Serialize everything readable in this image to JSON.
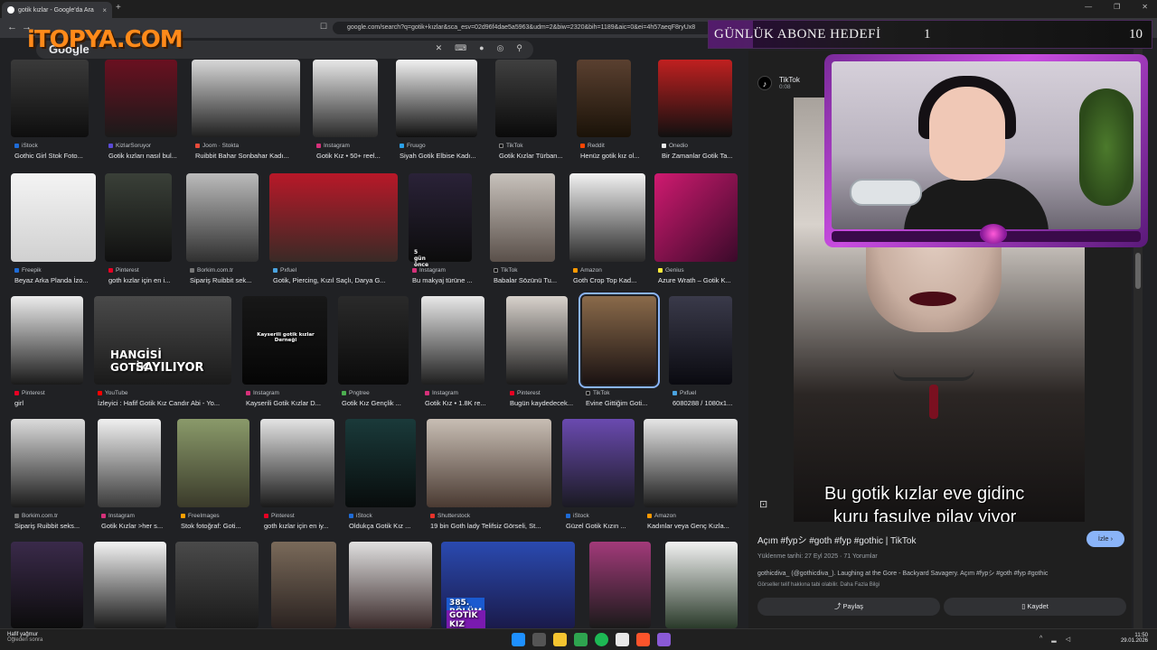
{
  "browser": {
    "tab_title": "gotik kızlar - Google'da Ara",
    "tab_close": "×",
    "new_tab": "+",
    "window_controls": [
      "—",
      "❐",
      "✕"
    ],
    "url": "google.com/search?q=gotik+kızlar&sca_esv=02d96f4dae5a5963&udm=2&biw=2320&bih=1189&aic=0&ei=4h57aeqF8ryUx8"
  },
  "logo": {
    "text": "iTOPYA.COM"
  },
  "search": {
    "brand": "Google",
    "icons": [
      "close-icon",
      "keyboard-icon",
      "mic-icon",
      "lens-icon",
      "search-icon"
    ]
  },
  "rows": [
    {
      "items": [
        {
          "source": "iStock",
          "title": "Gothic Girl Stok Foto..."
        },
        {
          "source": "KizlarSoruyor",
          "title": "Gotik kızları nasıl bul..."
        },
        {
          "source": "Joom · Stokta",
          "title": "Ruibbit Bahar Sonbahar Kadı..."
        },
        {
          "source": "Instagram",
          "title": "Gotik Kız • 50+ reel..."
        },
        {
          "source": "Fruugo",
          "title": "Siyah Gotik Elbise Kadı..."
        },
        {
          "source": "TikTok",
          "title": "Gotik Kızlar Türban..."
        },
        {
          "source": "Reddit",
          "title": "Henüz gotik kız ol..."
        },
        {
          "source": "Onedio",
          "title": "Bir Zamanlar Gotik Ta..."
        }
      ]
    },
    {
      "items": [
        {
          "source": "Freepik",
          "title": "Beyaz Arka Planda İzo..."
        },
        {
          "source": "Pinterest",
          "title": "goth kızlar için en i..."
        },
        {
          "source": "Borkim.com.tr",
          "title": "Sipariş Ruibbit sek..."
        },
        {
          "source": "Pxfuel",
          "title": "Gotik, Piercing, Kızıl Saçlı, Darya G..."
        },
        {
          "source": "Instagram",
          "title": "Bu makyaj türüne ..."
        },
        {
          "source": "TikTok",
          "title": "Babalar Sözünü Tu..."
        },
        {
          "source": "Amazon",
          "title": "Goth Crop Top Kad..."
        },
        {
          "source": "Genius",
          "title": "Azure Wrath – Gotik K..."
        }
      ],
      "overlays": {
        "badge": "5 gün önce"
      }
    },
    {
      "items": [
        {
          "source": "Pinterest",
          "title": "girl"
        },
        {
          "source": "YouTube",
          "title": "İzleyici : Hafif Gotik Kız Candır Abi - Yo..."
        },
        {
          "source": "Instagram",
          "title": "Kayserili Gotik Kızlar D..."
        },
        {
          "source": "Pngtree",
          "title": "Gotik Kız Gençlik ..."
        },
        {
          "source": "Instagram",
          "title": "Gotik Kız • 1.8K re..."
        },
        {
          "source": "Pinterest",
          "title": "Bugün kaydedecek..."
        },
        {
          "source": "TikTok",
          "title": "Evine Gittiğim Goti..."
        },
        {
          "source": "Pxfuel",
          "title": "6080288 / 1080x1..."
        }
      ],
      "overlays": {
        "youtube_text1": "HANGİSİ GOTİK",
        "youtube_text2": "SAYILIYOR",
        "kayseri": "Kayserili gotik kızlar Derneği"
      }
    },
    {
      "items": [
        {
          "source": "Borkim.com.tr",
          "title": "Sipariş Ruibbit seks..."
        },
        {
          "source": "Instagram",
          "title": "Gotik Kızlar >her s..."
        },
        {
          "source": "FreeImages",
          "title": "Stok fotoğraf: Goti..."
        },
        {
          "source": "Pinterest",
          "title": "goth kızlar için en iy..."
        },
        {
          "source": "iStock",
          "title": "Oldukça Gotik Kız ..."
        },
        {
          "source": "Shutterstock",
          "title": "19 bin Goth lady Telifsiz Görseli, St..."
        },
        {
          "source": "iStock",
          "title": "Güzel Gotik Kızın ..."
        },
        {
          "source": "Amazon",
          "title": "Kadınlar veya Genç Kızla..."
        }
      ]
    },
    {
      "items": [
        {
          "source": "",
          "title": ""
        },
        {
          "source": "",
          "title": ""
        },
        {
          "source": "",
          "title": ""
        },
        {
          "source": "",
          "title": ""
        },
        {
          "source": "",
          "title": ""
        },
        {
          "source": "",
          "title": ""
        },
        {
          "source": "",
          "title": ""
        },
        {
          "source": "",
          "title": ""
        }
      ],
      "overlays": {
        "ep": "385. BÖLÜM",
        "ep2": "GOTİK KIZ İSTEME"
      }
    }
  ],
  "goal": {
    "label": "GÜNLÜK ABONE HEDEFİ",
    "current": "1",
    "target": "10",
    "progress": 0.1
  },
  "panel": {
    "source_name": "TikTok",
    "source_time": "0:08",
    "caption_line1": "Bu gotik kızlar eve gidinc",
    "caption_line2": "kuru fasulye pilav yiyor",
    "title": "Açım #fypシ #goth #fyp #gothic | TikTok",
    "watch_button": "İzle",
    "uploaded": "Yüklenme tarihi: 27 Eyl 2025",
    "comments": "71 Yorumlar",
    "description": "gothicdiva_ (@gothicdiva_). Laughing at the Gore - Backyard Savagery. Açım #fypシ #goth #fyp #gothic",
    "copyright": "Görseller telif hakkına tabi olabilir. Daha Fazla Bilgi",
    "share_button": "Paylaş",
    "save_button": "Kaydet"
  },
  "taskbar": {
    "weather_title": "Hafif yağmur",
    "weather_sub": "Öğleden sonra",
    "time": "11:50",
    "date": "29.01.2026"
  }
}
